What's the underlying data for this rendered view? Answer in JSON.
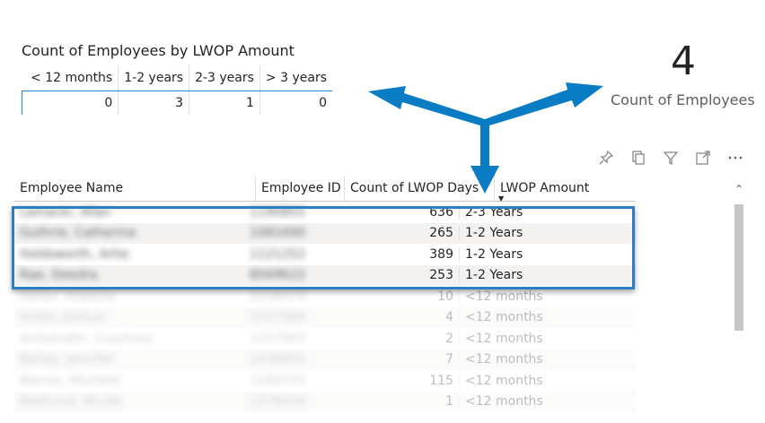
{
  "matrix": {
    "title": "Count of Employees by LWOP Amount",
    "headers": [
      "< 12 months",
      "1-2 years",
      "2-3 years",
      "> 3 years"
    ],
    "values": [
      "0",
      "3",
      "1",
      "0"
    ]
  },
  "kpi": {
    "value": "4",
    "label": "Count of Employees"
  },
  "toolbar": {
    "icons": [
      "pin-icon",
      "copy-icon",
      "filter-icon",
      "focus-mode-icon",
      "more-options-icon"
    ]
  },
  "table": {
    "columns": [
      "Employee Name",
      "Employee ID",
      "Count of LWOP Days",
      "LWOP Amount"
    ],
    "sorted_column": "LWOP Amount",
    "rows": [
      {
        "name": "Lamacki, Allan",
        "id": "1190855",
        "days": "636",
        "amount": "2-3 Years"
      },
      {
        "name": "Guthrie, Catherine",
        "id": "1081690",
        "days": "265",
        "amount": "1-2 Years"
      },
      {
        "name": "Holdsworth, Artie",
        "id": "1121252",
        "days": "389",
        "amount": "1-2 Years"
      },
      {
        "name": "Rae, Deedra",
        "id": "8569622",
        "days": "253",
        "amount": "1-2 Years"
      },
      {
        "name": "Abner, Rowena",
        "id": "1238079",
        "days": "10",
        "amount": "<12 months"
      },
      {
        "name": "Amiel, Joshua",
        "id": "1037389",
        "days": "4",
        "amount": "<12 months"
      },
      {
        "name": "Armstrafer, Courtney",
        "id": "1227563",
        "days": "2",
        "amount": "<12 months"
      },
      {
        "name": "Bailey, Jennifer",
        "id": "1038950",
        "days": "7",
        "amount": "<12 months"
      },
      {
        "name": "Barron, Michelle",
        "id": "1160733",
        "days": "115",
        "amount": "<12 months"
      },
      {
        "name": "Bellhund, Nicole",
        "id": "1278434",
        "days": "1",
        "amount": "<12 months"
      }
    ]
  },
  "colors": {
    "accent": "#0078d4",
    "highlight_border": "#2e7fc1"
  }
}
